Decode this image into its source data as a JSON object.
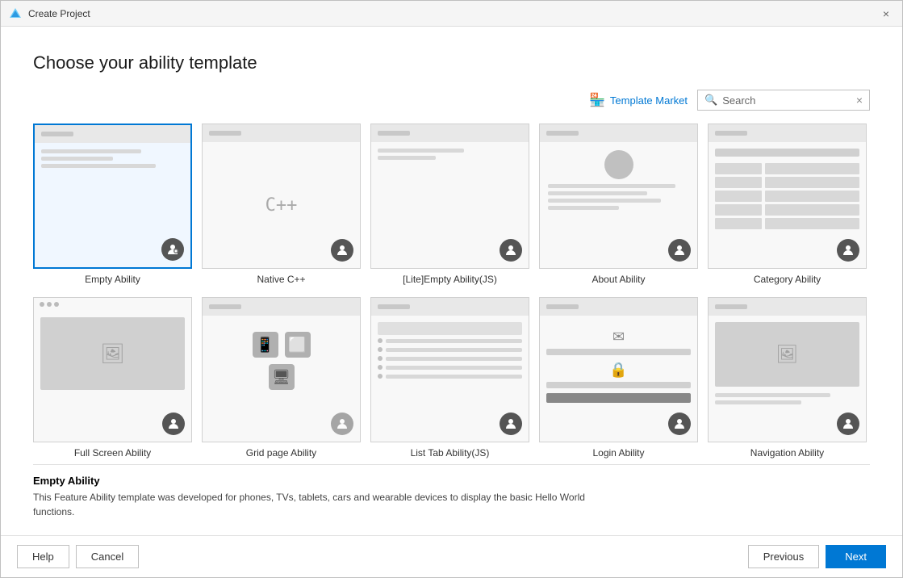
{
  "window": {
    "title": "Create Project",
    "close_label": "×"
  },
  "page": {
    "title": "Choose your ability template"
  },
  "toolbar": {
    "template_market_label": "Template Market",
    "search_placeholder": "Search",
    "search_value": "Search"
  },
  "templates": [
    {
      "id": "empty-ability",
      "label": "Empty Ability",
      "selected": true,
      "type": "empty"
    },
    {
      "id": "native-cpp",
      "label": "Native C++",
      "selected": false,
      "type": "cpp"
    },
    {
      "id": "lite-empty-js",
      "label": "[Lite]Empty Ability(JS)",
      "selected": false,
      "type": "lite"
    },
    {
      "id": "about-ability",
      "label": "About Ability",
      "selected": false,
      "type": "about"
    },
    {
      "id": "category-ability",
      "label": "Category Ability",
      "selected": false,
      "type": "category"
    },
    {
      "id": "full-screen-ability",
      "label": "Full Screen Ability",
      "selected": false,
      "type": "fullscreen"
    },
    {
      "id": "grid-page-ability",
      "label": "Grid page Ability",
      "selected": false,
      "type": "grid"
    },
    {
      "id": "list-tab-ability",
      "label": "List Tab Ability(JS)",
      "selected": false,
      "type": "listtab"
    },
    {
      "id": "login-ability",
      "label": "Login Ability",
      "selected": false,
      "type": "login"
    },
    {
      "id": "navigation-ability",
      "label": "Navigation Ability",
      "selected": false,
      "type": "navigation"
    }
  ],
  "description": {
    "title": "Empty Ability",
    "text_part1": "This Feature Ability template was developed for phones, TVs, tablets, cars and wearable devices to display the basic Hello World",
    "link_text": "",
    "text_part2": "functions."
  },
  "footer": {
    "help_label": "Help",
    "cancel_label": "Cancel",
    "previous_label": "Previous",
    "next_label": "Next"
  }
}
